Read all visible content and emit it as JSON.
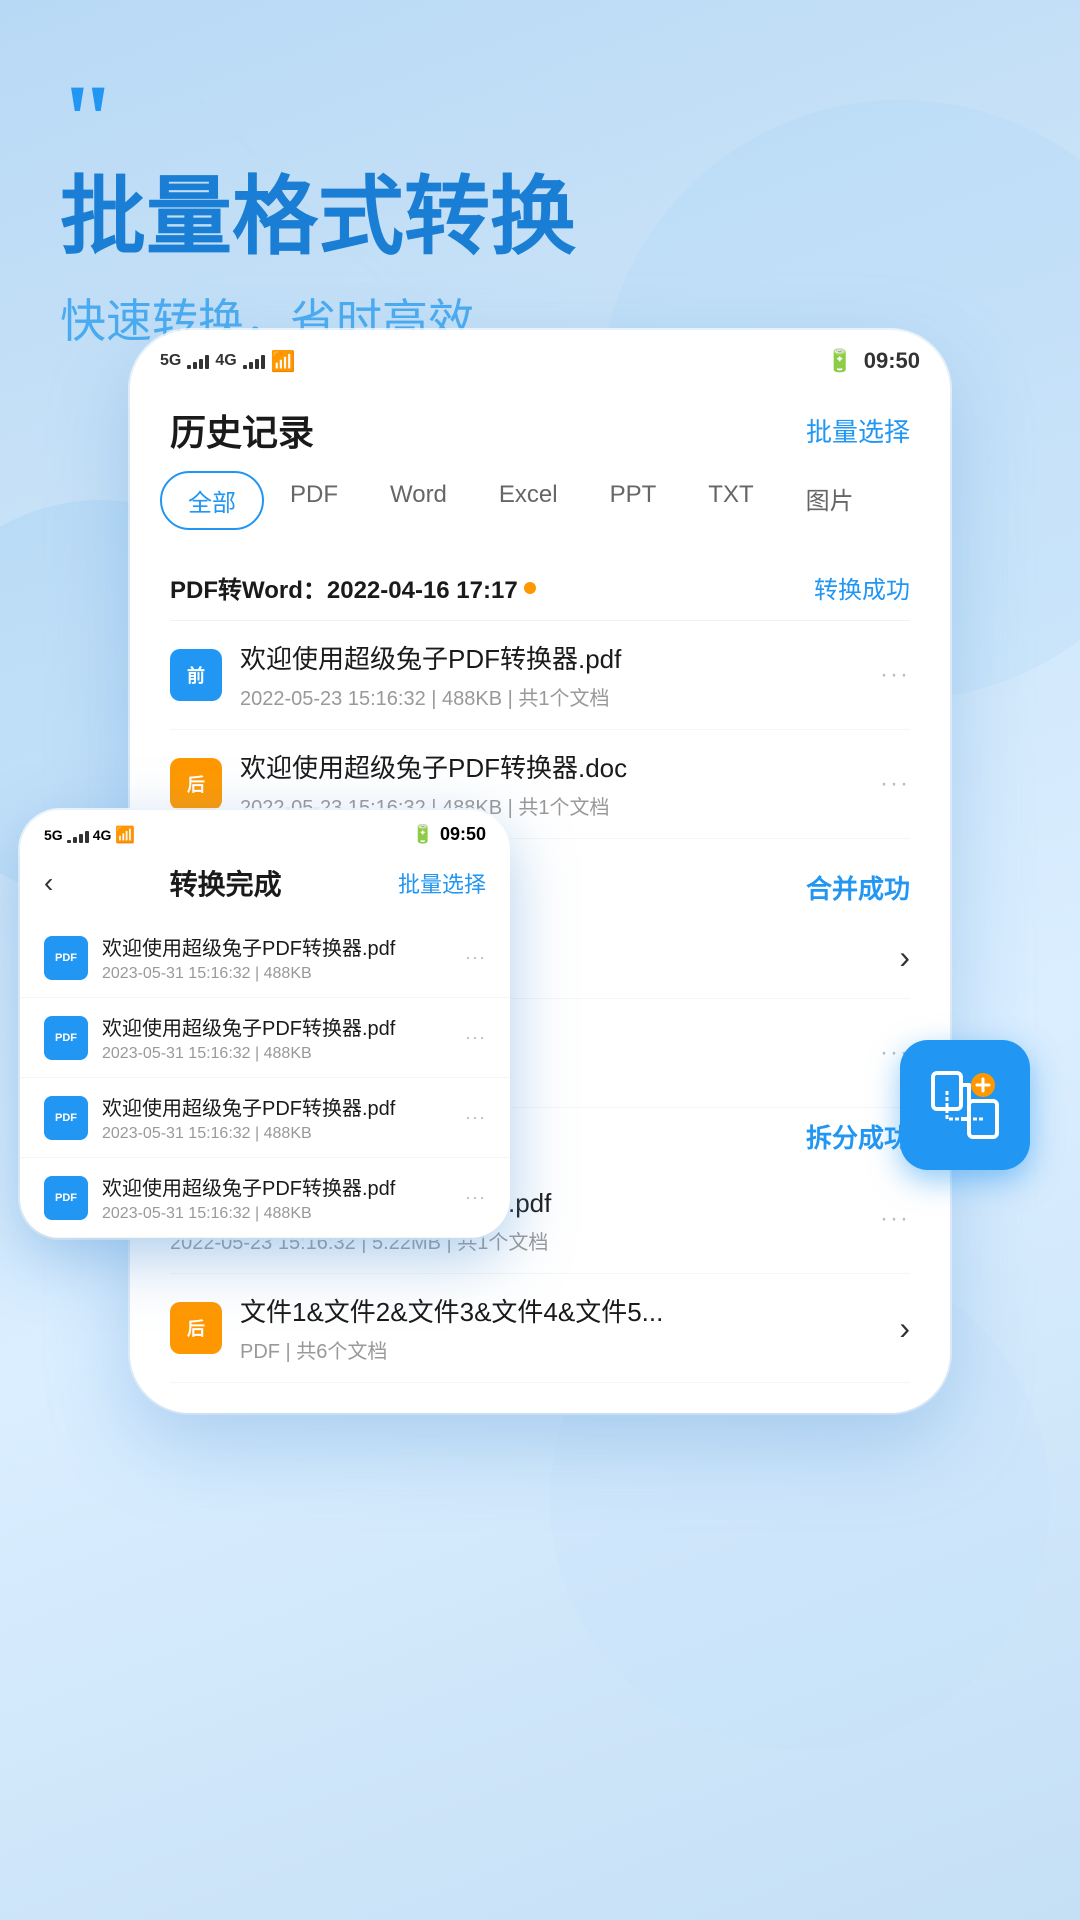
{
  "header": {
    "quote_mark": "❝",
    "headline": "批量格式转换",
    "subheadline": "快速转换，省时高效"
  },
  "main_phone": {
    "status_bar": {
      "left": "5G  4G  ▲▼  ☁",
      "time": "09:50",
      "network_labels": [
        "5G",
        "4G"
      ]
    },
    "title": "历史记录",
    "batch_select": "批量选择",
    "tabs": [
      {
        "label": "全部",
        "active": true
      },
      {
        "label": "PDF",
        "active": false
      },
      {
        "label": "Word",
        "active": false
      },
      {
        "label": "Excel",
        "active": false
      },
      {
        "label": "PPT",
        "active": false
      },
      {
        "label": "TXT",
        "active": false
      },
      {
        "label": "图片",
        "active": false
      }
    ],
    "conversion_group": {
      "title": "PDF转Word：2022-04-16 17:17",
      "has_dot": true,
      "status": "转换成功",
      "files": [
        {
          "badge": "前",
          "badge_type": "before",
          "name": "欢迎使用超级兔子PDF转换器.pdf",
          "meta": "2022-05-23  15:16:32  |  488KB  |  共1个文档"
        },
        {
          "badge": "后",
          "badge_type": "after",
          "name": "欢迎使用超级兔子PDF转换器.doc",
          "meta": "2022-05-23  15:16:32  |  488KB  |  共1个文档"
        }
      ]
    },
    "merge_success": "合并成功",
    "split_success": "拆分成功",
    "split_group": {
      "name": "欢迎使用超级兔子PDF转换器.pdf",
      "meta": "2022-05-23  15:16:32  |  5.22MB  |  共1个文档"
    },
    "merge_group": {
      "name": "文件1&文件2&文件3&文件4&文件5...",
      "meta": "PDF  |  共6个文档"
    }
  },
  "secondary_phone": {
    "status_bar": {
      "time": "09:50"
    },
    "back": "‹",
    "title": "转换完成",
    "batch_select": "批量选择",
    "files": [
      {
        "name": "欢迎使用超级兔子PDF转换器.pdf",
        "meta": "2023-05-31  15:16:32  |  488KB"
      },
      {
        "name": "欢迎使用超级兔子PDF转换器.pdf",
        "meta": "2023-05-31  15:16:32  |  488KB"
      },
      {
        "name": "欢迎使用超级兔子PDF转换器.pdf",
        "meta": "2023-05-31  15:16:32  |  488KB"
      },
      {
        "name": "欢迎使用超级兔子PDF转换器.pdf",
        "meta": "2023-05-31  15:16:32  |  488KB"
      }
    ]
  },
  "icons": {
    "merge_icon": "⤢",
    "more_dots": "···",
    "arrow_right": "›"
  }
}
